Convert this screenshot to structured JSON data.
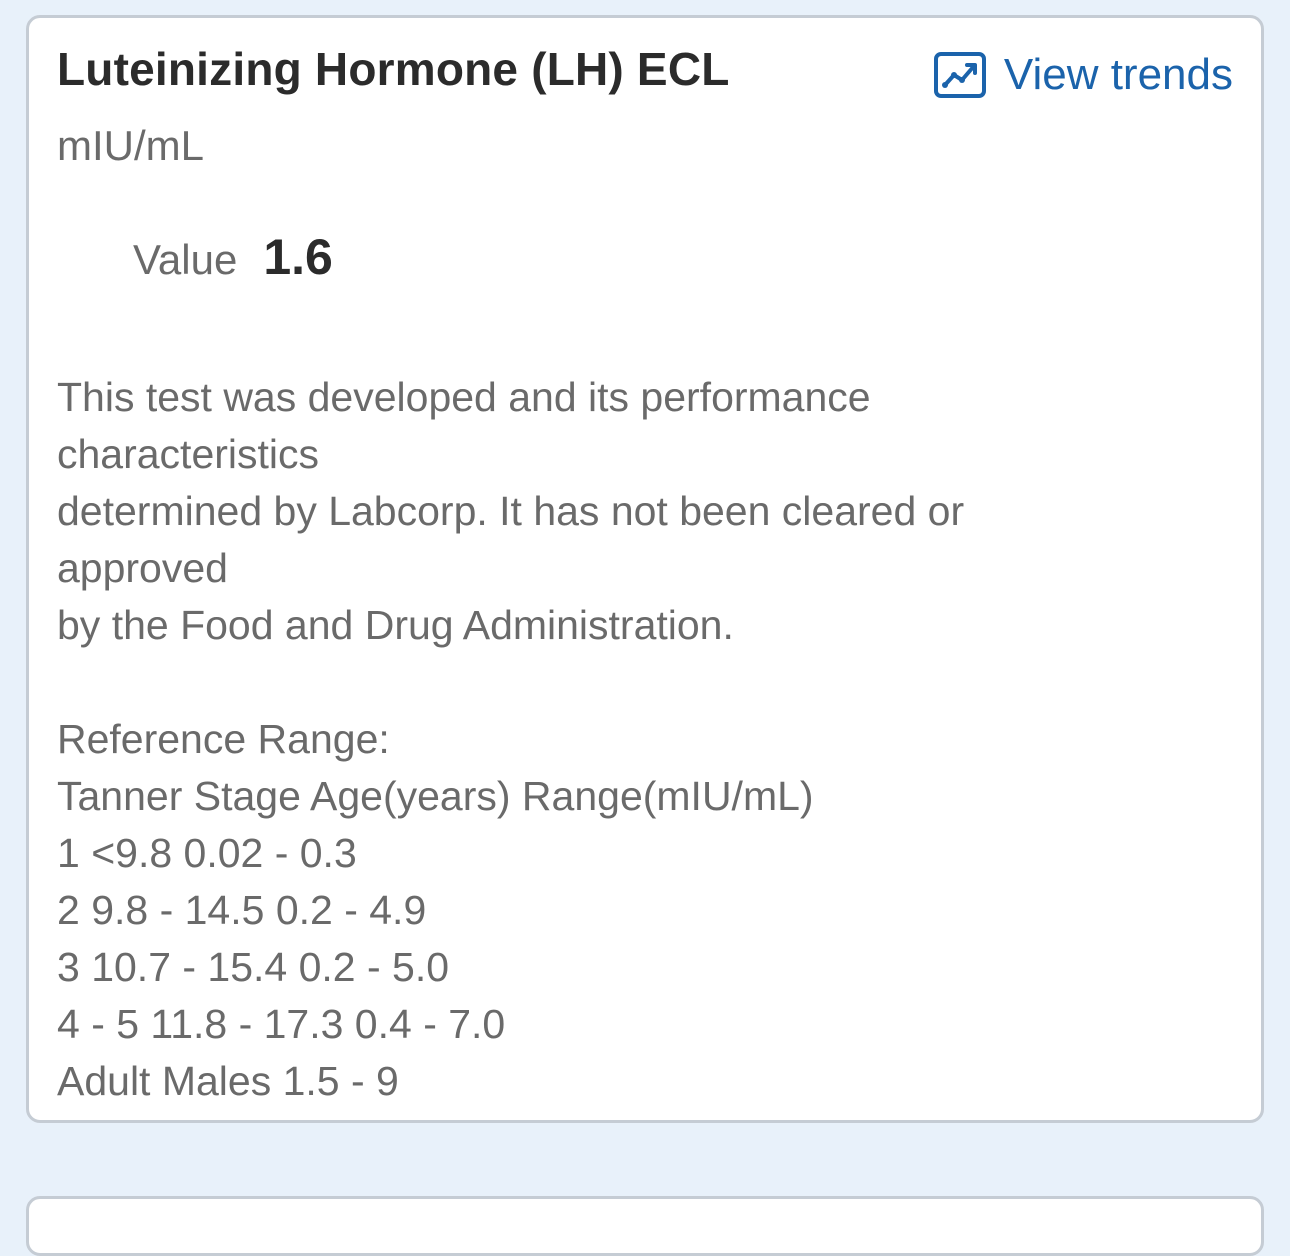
{
  "result": {
    "title": "Luteinizing Hormone (LH) ECL",
    "unit": "mIU/mL",
    "view_trends_label": "View trends",
    "value_label": "Value",
    "value": "1.6",
    "comment_lines": [
      "This test was developed and its performance",
      "characteristics",
      "determined by Labcorp. It has not been cleared or",
      "approved",
      "by the Food and Drug Administration."
    ],
    "reference_lines": [
      "Reference Range:",
      "Tanner Stage Age(years) Range(mIU/mL)",
      "1 <9.8 0.02 - 0.3",
      "2 9.8 - 14.5 0.2 - 4.9",
      "3 10.7 - 15.4 0.2 - 5.0",
      "4 - 5 11.8 - 17.3 0.4 - 7.0",
      "Adult Males 1.5 - 9"
    ]
  },
  "colors": {
    "background": "#e8f1fa",
    "card": "#ffffff",
    "card_border": "#c5ccd4",
    "link": "#1b63ab",
    "title_text": "#2b2b2b",
    "body_text": "#6a6a6a"
  },
  "icons": {
    "view_trends": "trend-chart-icon"
  }
}
